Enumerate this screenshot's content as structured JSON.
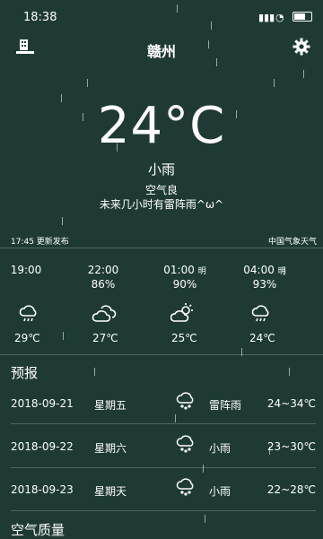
{
  "status_bar": {
    "time": "18:38",
    "battery": "",
    "signal": "",
    "wifi": ""
  },
  "header": {
    "city": "赣州"
  },
  "current": {
    "temperature": "24°C",
    "condition": "小雨",
    "air_quality": "空气良",
    "tip": "未来几小时有雷阵雨^ω^"
  },
  "publish": {
    "time": "17:45 更新发布",
    "source": "中国气象天气"
  },
  "hourly": [
    {
      "time": "19:00",
      "suffix": "",
      "humidity": "",
      "icon": "rain-cloud-icon",
      "temp": "29℃"
    },
    {
      "time": "22:00",
      "suffix": "",
      "humidity": "86%",
      "icon": "cloudy-icon",
      "temp": "27℃"
    },
    {
      "time": "01:00",
      "suffix": "明",
      "humidity": "90%",
      "icon": "partly-cloudy-icon",
      "temp": "25℃"
    },
    {
      "time": "04:00",
      "suffix": "明",
      "humidity": "93%",
      "icon": "rain-cloud-icon",
      "temp": "24℃"
    }
  ],
  "forecast": {
    "title": "预报",
    "days": [
      {
        "date": "2018-09-21",
        "weekday": "星期五",
        "icon": "thunder-rain-icon",
        "weather": "雷阵雨",
        "range": "24~34℃"
      },
      {
        "date": "2018-09-22",
        "weekday": "星期六",
        "icon": "light-rain-icon",
        "weather": "小雨",
        "range": "23~30℃"
      },
      {
        "date": "2018-09-23",
        "weekday": "星期天",
        "icon": "light-rain-icon",
        "weather": "小雨",
        "range": "22~28℃"
      }
    ]
  },
  "air": {
    "title": "空气质量"
  }
}
